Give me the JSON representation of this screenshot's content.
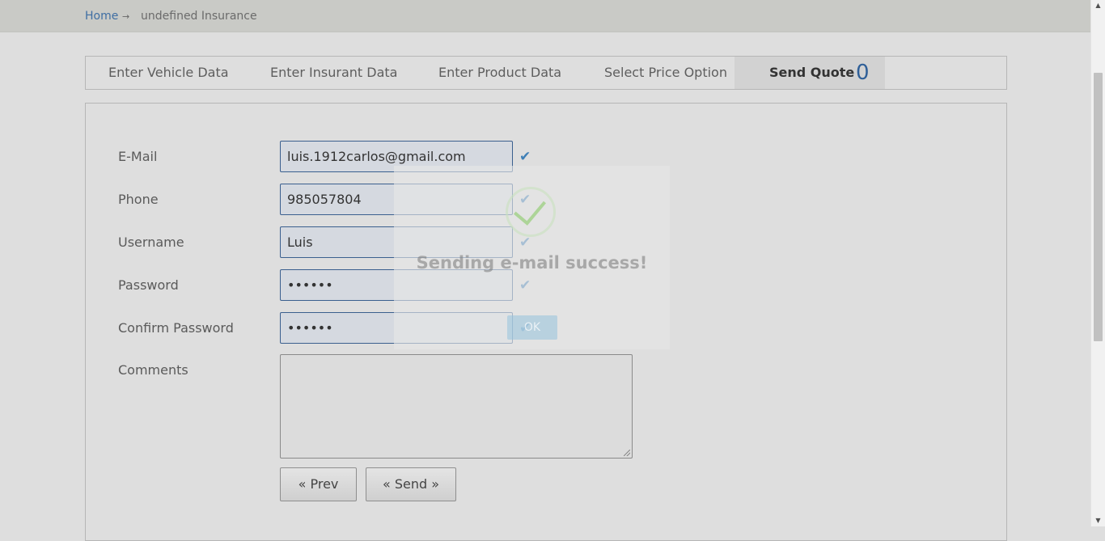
{
  "breadcrumb": {
    "home": "Home",
    "separator": "→",
    "current": "undefined Insurance"
  },
  "tabs": [
    {
      "label": "Enter Vehicle Data"
    },
    {
      "label": "Enter Insurant Data"
    },
    {
      "label": "Enter Product Data"
    },
    {
      "label": "Select Price Option"
    },
    {
      "label": "Send Quote",
      "count": "0"
    }
  ],
  "form": {
    "email": {
      "label": "E-Mail",
      "value": "luis.1912carlos@gmail.com"
    },
    "phone": {
      "label": "Phone",
      "value": "985057804"
    },
    "username": {
      "label": "Username",
      "value": "Luis"
    },
    "password": {
      "label": "Password",
      "value": "••••••"
    },
    "confirm_password": {
      "label": "Confirm Password",
      "value": "••••••"
    },
    "comments": {
      "label": "Comments",
      "value": ""
    }
  },
  "buttons": {
    "prev": "« Prev",
    "send": "« Send »"
  },
  "modal": {
    "title": "Sending e-mail success!",
    "ok": "OK"
  },
  "icons": {
    "check": "✔",
    "scroll_up": "▲",
    "scroll_down": "▼"
  },
  "colors": {
    "accent": "#3f6ea3",
    "count": "#2f5f98",
    "field_border": "#3a5f8e"
  }
}
